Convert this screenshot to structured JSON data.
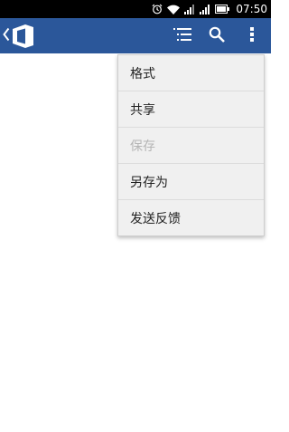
{
  "status_bar": {
    "time": "07:50",
    "icons": [
      "alarm-icon",
      "wifi-icon",
      "signal-icon",
      "signal-icon",
      "battery-icon"
    ]
  },
  "app_bar": {
    "background": "#2b579a",
    "icons": [
      "back-chevron-icon",
      "office-logo-icon",
      "outline-icon",
      "search-icon",
      "more-vert-icon"
    ]
  },
  "menu": {
    "items": [
      {
        "label": "格式",
        "enabled": true
      },
      {
        "label": "共享",
        "enabled": true
      },
      {
        "label": "保存",
        "enabled": false
      },
      {
        "label": "另存为",
        "enabled": true
      },
      {
        "label": "发送反馈",
        "enabled": true
      }
    ]
  }
}
